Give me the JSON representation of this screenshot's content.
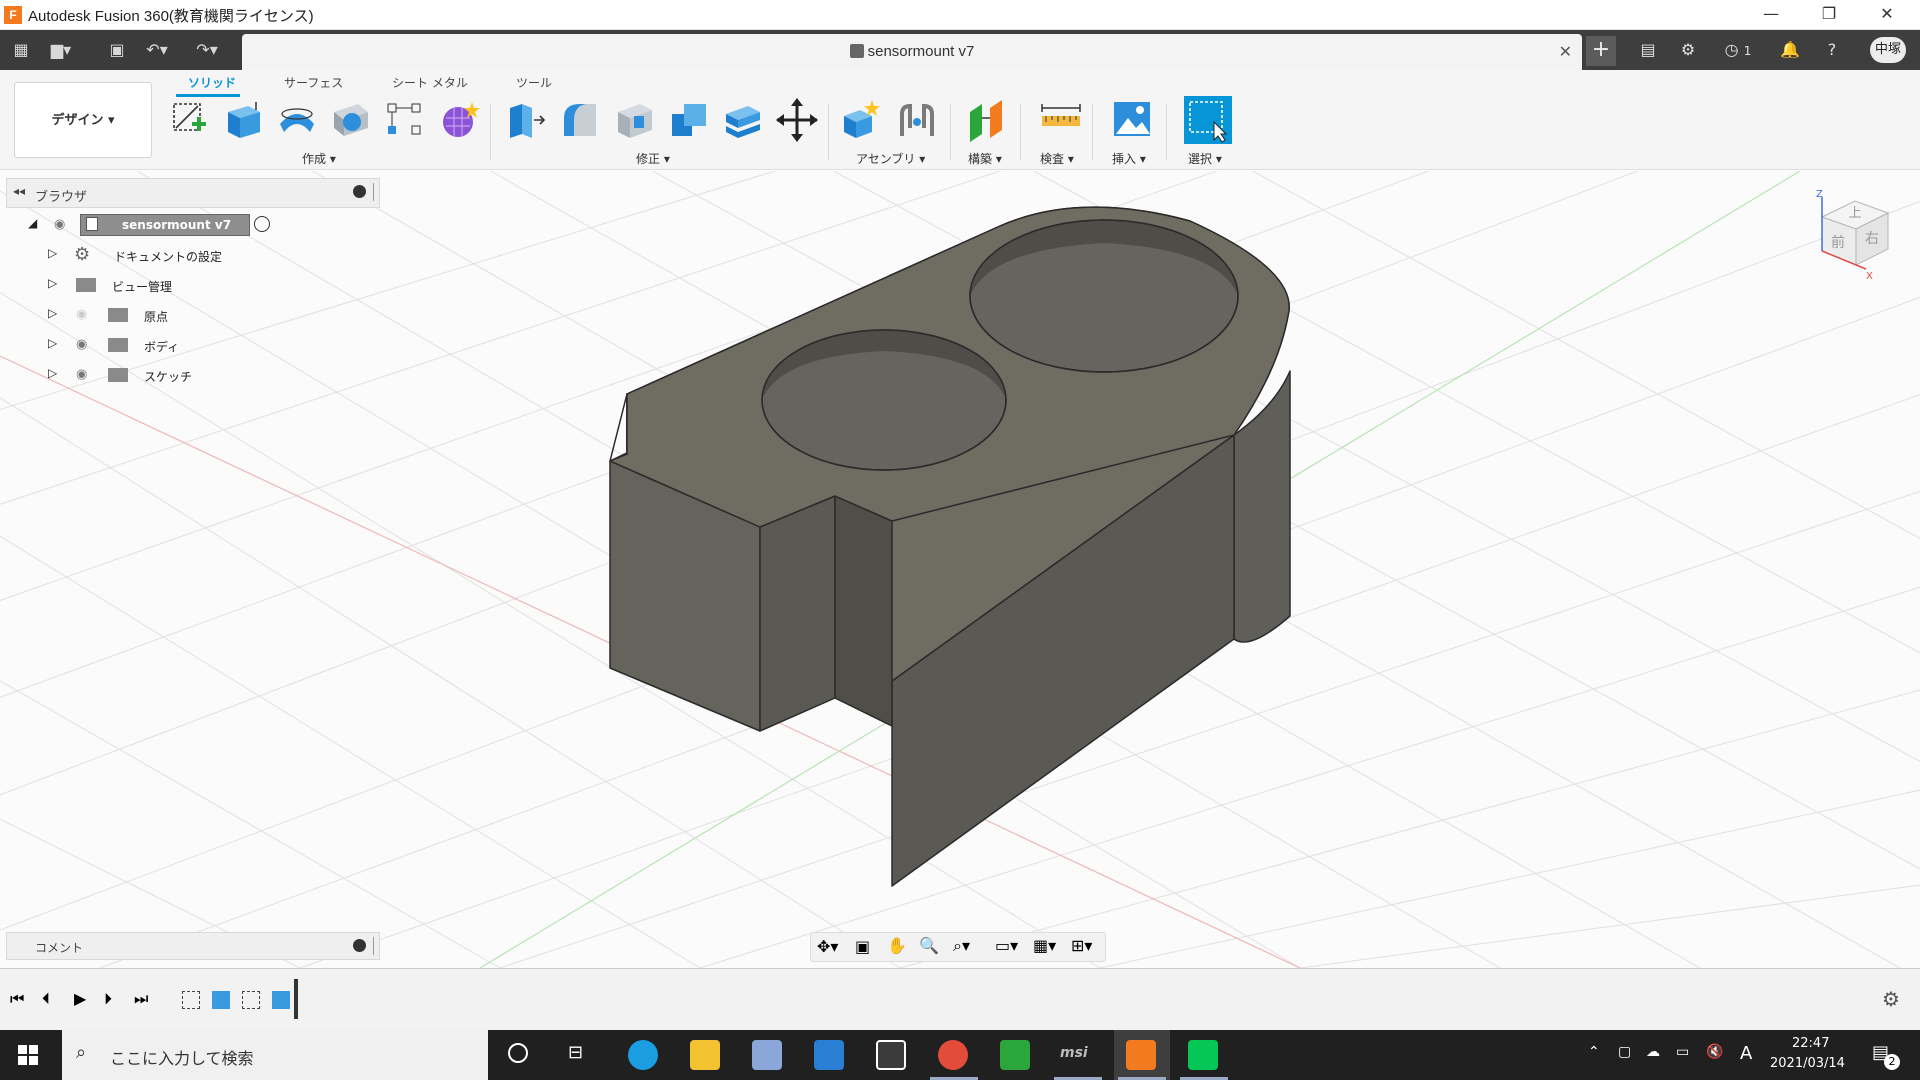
{
  "window": {
    "title": "Autodesk Fusion 360(教育機関ライセンス)",
    "app_icon": "F",
    "controls": [
      "—",
      "❐",
      "✕"
    ]
  },
  "doc": {
    "tab_title": "sensormount v7",
    "close": "✕"
  },
  "quickbar": {
    "job_count": "1",
    "user_initials": "中塚"
  },
  "ribbon": {
    "workspace": "デザイン ▾",
    "tabs": [
      "ソリッド",
      "サーフェス",
      "シート メタル",
      "ツール"
    ],
    "active_tab": 0,
    "groups": {
      "create": "作成 ▾",
      "modify": "修正 ▾",
      "assemble": "アセンブリ ▾",
      "construct": "構築 ▾",
      "inspect": "検査 ▾",
      "insert": "挿入 ▾",
      "select": "選択 ▾"
    }
  },
  "browser": {
    "title": "ブラウザ",
    "root": "sensormount v7",
    "items": [
      {
        "label": "ドキュメントの設定",
        "icon": "gear-icon"
      },
      {
        "label": "ビュー管理",
        "icon": "folder-icon"
      },
      {
        "label": "原点",
        "icon": "folder-icon",
        "hidden": true
      },
      {
        "label": "ボディ",
        "icon": "folder-icon"
      },
      {
        "label": "スケッチ",
        "icon": "folder-icon"
      }
    ]
  },
  "comments": {
    "title": "コメント"
  },
  "viewcube": {
    "top": "上",
    "front": "前",
    "right": "右",
    "axis_z": "Z",
    "axis_x": "X"
  },
  "taskbar": {
    "search_placeholder": "ここに入力して検索",
    "ime": "A",
    "time": "22:47",
    "date": "2021/03/14",
    "notifications": "2"
  },
  "colors": {
    "accent": "#0696d7",
    "body_top": "#6f6d62",
    "body_side_dark": "#575650",
    "body_side_light": "#66655e"
  }
}
